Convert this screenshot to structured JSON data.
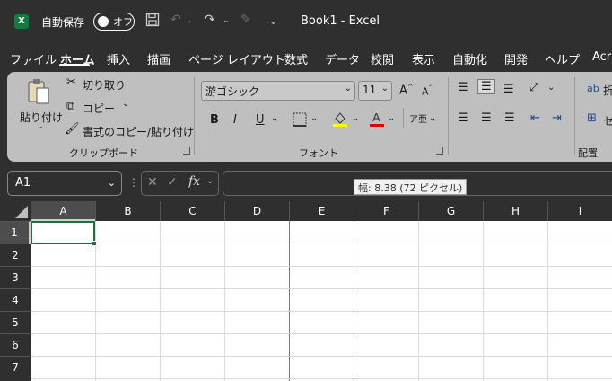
{
  "titlebar": {
    "app_logo": "X",
    "autosave_label": "自動保存",
    "autosave_state": "オフ",
    "doc_title": "Book1  -  Excel"
  },
  "tabs": [
    "ファイル",
    "ホーム",
    "挿入",
    "描画",
    "ページ レイアウト",
    "数式",
    "データ",
    "校閲",
    "表示",
    "自動化",
    "開発",
    "ヘルプ",
    "Acr"
  ],
  "active_tab": "ホーム",
  "clipboard": {
    "paste": "貼り付け",
    "cut": "切り取り",
    "copy": "コピー",
    "format_painter": "書式のコピー/貼り付け",
    "group_label": "クリップボード"
  },
  "font": {
    "font_name": "游ゴシック",
    "font_size": "11",
    "group_label": "フォント",
    "bold": "B",
    "italic": "I",
    "underline": "U"
  },
  "alignment": {
    "group_label": "配置",
    "wrap_partial": "折",
    "merge_partial": "セ"
  },
  "formula_bar": {
    "name_box": "A1",
    "fx": "fx"
  },
  "tooltip": "幅: 8.38 (72 ピクセル)",
  "grid": {
    "columns": [
      "A",
      "B",
      "C",
      "D",
      "E",
      "F",
      "G",
      "H",
      "I"
    ],
    "rows": [
      "1",
      "2",
      "3",
      "4",
      "5",
      "6",
      "7"
    ],
    "active_cell": "A1",
    "accent": "#1e6f3e"
  }
}
